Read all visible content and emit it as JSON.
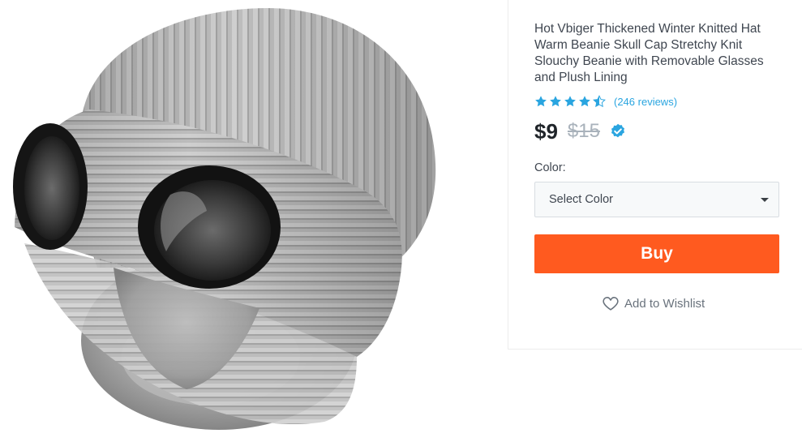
{
  "product": {
    "title": "Hot Vbiger Thickened Winter Knitted Hat Warm Beanie Skull Cap Stretchy Knit Slouchy Beanie with Removable Glasses and Plush Lining",
    "image_alt": "grey knitted beanie with goggles"
  },
  "rating": {
    "stars": 4.5,
    "reviews_text": "(246 reviews)",
    "star_color": "#2aa5e0"
  },
  "pricing": {
    "price": "$9",
    "old_price": "$15",
    "verified_icon": "verified-check-icon"
  },
  "color_select": {
    "label": "Color:",
    "selected": "Select Color"
  },
  "buy_button": {
    "label": "Buy",
    "color": "#ff5a1f"
  },
  "wishlist": {
    "label": "Add to Wishlist",
    "icon": "heart-icon"
  }
}
